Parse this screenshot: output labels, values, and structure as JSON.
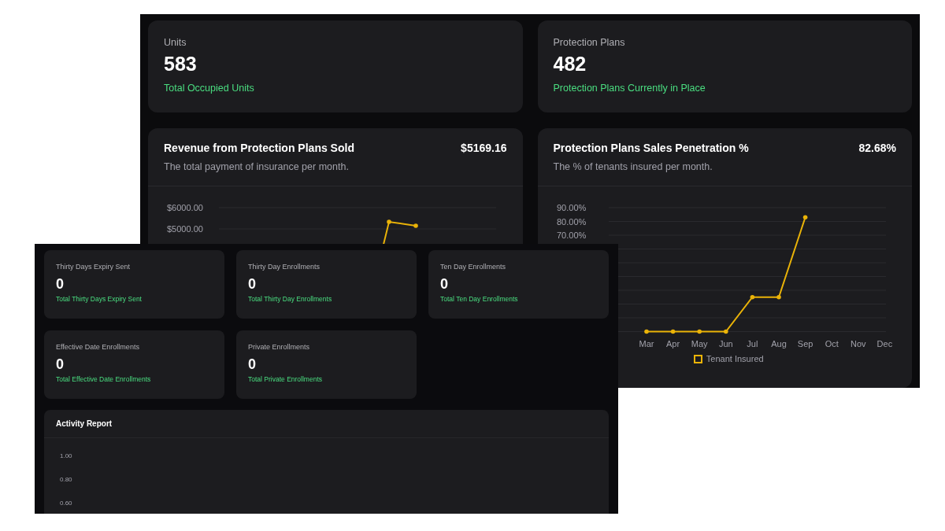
{
  "back_window": {
    "stats": [
      {
        "label": "Units",
        "value": "583",
        "caption": "Total Occupied Units"
      },
      {
        "label": "Protection Plans",
        "value": "482",
        "caption": "Protection Plans Currently in Place"
      }
    ],
    "charts": [
      {
        "title": "Revenue from Protection Plans Sold",
        "total": "$5169.16",
        "subtitle": "The total payment of insurance per month.",
        "y_ticks": [
          "$6000.00",
          "$5000.00"
        ]
      },
      {
        "title": "Protection Plans Sales Penetration %",
        "total": "82.68%",
        "subtitle": "The % of tenants insured per month.",
        "chart_data": {
          "type": "line",
          "ylim": [
            0,
            90
          ],
          "yticks": [
            {
              "value": 90,
              "label": "90.00%"
            },
            {
              "value": 80,
              "label": "80.00%"
            },
            {
              "value": 70,
              "label": "70.00%"
            }
          ],
          "categories": [
            "Mar",
            "Apr",
            "May",
            "Jun",
            "Jul",
            "Aug",
            "Sep",
            "Oct",
            "Nov",
            "Dec"
          ],
          "series": [
            {
              "name": "Tenant Insured",
              "color": "#eab308",
              "values": [
                0,
                0,
                0,
                0,
                25,
                25,
                83,
                null,
                null,
                null
              ]
            }
          ]
        }
      }
    ]
  },
  "front_window": {
    "stats": [
      {
        "label": "Thirty Days Expiry Sent",
        "value": "0",
        "caption": "Total Thirty Days Expiry Sent"
      },
      {
        "label": "Thirty Day Enrollments",
        "value": "0",
        "caption": "Total Thirty Day Enrollments"
      },
      {
        "label": "Ten Day Enrollments",
        "value": "0",
        "caption": "Total Ten Day Enrollments"
      },
      {
        "label": "Effective Date Enrollments",
        "value": "0",
        "caption": "Total Effective Date Enrollments"
      },
      {
        "label": "Private Enrollments",
        "value": "0",
        "caption": "Total Private Enrollments"
      }
    ],
    "activity": {
      "title": "Activity Report",
      "y_ticks": [
        "1.00",
        "0.80",
        "0.60"
      ]
    }
  }
}
